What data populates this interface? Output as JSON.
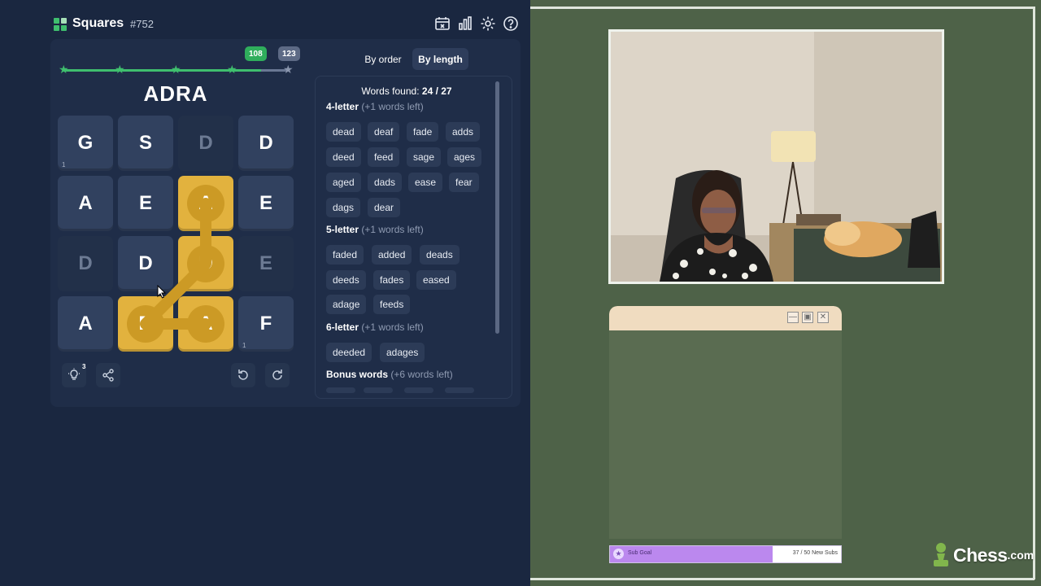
{
  "game": {
    "title": "Squares",
    "puzzle_number": "#752",
    "icons": [
      "calendar-icon",
      "stats-icon",
      "settings-icon",
      "help-icon"
    ],
    "progress": {
      "milestone_1": "108",
      "milestone_2": "123",
      "fraction": 0.88
    },
    "current_word": "ADRA",
    "grid": [
      [
        {
          "l": "G",
          "n": "1",
          "s": "normal"
        },
        {
          "l": "S",
          "n": "",
          "s": "normal"
        },
        {
          "l": "D",
          "n": "",
          "s": "dim"
        },
        {
          "l": "D",
          "n": "",
          "s": "normal"
        }
      ],
      [
        {
          "l": "A",
          "n": "",
          "s": "normal"
        },
        {
          "l": "E",
          "n": "",
          "s": "normal"
        },
        {
          "l": "A",
          "n": "",
          "s": "selected"
        },
        {
          "l": "E",
          "n": "",
          "s": "normal"
        }
      ],
      [
        {
          "l": "D",
          "n": "",
          "s": "dim"
        },
        {
          "l": "D",
          "n": "",
          "s": "normal"
        },
        {
          "l": "D",
          "n": "",
          "s": "selected"
        },
        {
          "l": "E",
          "n": "",
          "s": "dim"
        }
      ],
      [
        {
          "l": "A",
          "n": "",
          "s": "normal"
        },
        {
          "l": "R",
          "n": "",
          "s": "selected"
        },
        {
          "l": "A",
          "n": "",
          "s": "selected"
        },
        {
          "l": "F",
          "n": "1",
          "s": "normal"
        }
      ]
    ],
    "hint_count": "3",
    "sort": {
      "by_order": "By order",
      "by_length": "By length",
      "active": "by_length"
    },
    "words_found_label": "Words found:",
    "words_found_value": "24 / 27",
    "groups": [
      {
        "title": "4-letter",
        "left": "(+1 words left)",
        "words": [
          "dead",
          "deaf",
          "fade",
          "adds",
          "deed",
          "feed",
          "sage",
          "ages",
          "aged",
          "dads",
          "ease",
          "fear",
          "dags",
          "dear"
        ]
      },
      {
        "title": "5-letter",
        "left": "(+1 words left)",
        "words": [
          "faded",
          "added",
          "deads",
          "deeds",
          "fades",
          "eased",
          "adage",
          "feeds"
        ]
      },
      {
        "title": "6-letter",
        "left": "(+1 words left)",
        "words": [
          "deeded",
          "adages"
        ]
      },
      {
        "title": "Bonus words",
        "left": "(+6 words left)",
        "words": []
      }
    ]
  },
  "overlay": {
    "window_buttons": {
      "minimize": "—",
      "maximize": "▣",
      "close": "✕"
    },
    "sub_goal": {
      "label": "Sub Goal",
      "count": "37 / 50 New Subs",
      "fraction": 0.74,
      "color": "#bb88ee"
    },
    "brand": {
      "name": "Chess",
      "suffix": ".com"
    }
  },
  "colors": {
    "tile_selected": "#e2b23e",
    "progress_green": "#3fbf6e",
    "panel_bg": "#1a2740",
    "stream_bg": "#4e6248"
  }
}
